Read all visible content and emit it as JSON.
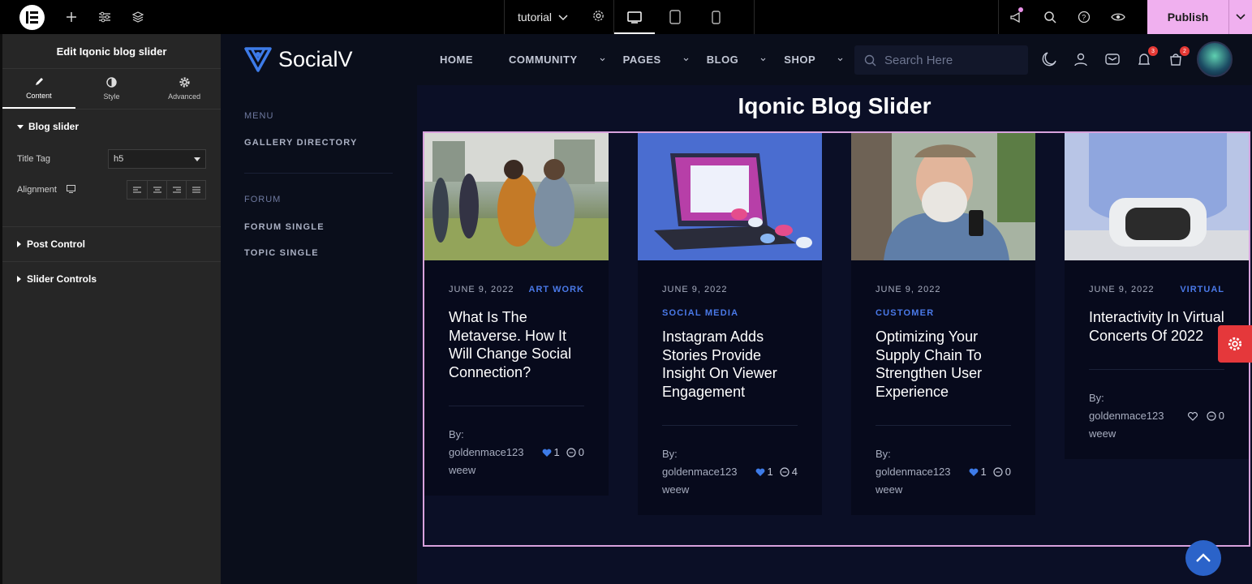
{
  "editor": {
    "doc_name": "tutorial",
    "publish_label": "Publish"
  },
  "panel": {
    "title": "Edit Iqonic blog slider",
    "tabs": [
      "Content",
      "Style",
      "Advanced"
    ],
    "section_blog": "Blog slider",
    "title_tag_label": "Title Tag",
    "title_tag_value": "h5",
    "alignment_label": "Alignment",
    "section_post": "Post Control",
    "section_slider": "Slider Controls"
  },
  "site": {
    "brand": "SocialV",
    "nav": [
      "HOME",
      "COMMUNITY",
      "PAGES",
      "BLOG",
      "SHOP"
    ],
    "search_placeholder": "Search Here",
    "notif_count": "3",
    "cart_count": "2",
    "side_menu": {
      "h1": "MENU",
      "i1": "GALLERY DIRECTORY",
      "h2": "FORUM",
      "i2": "FORUM SINGLE",
      "i3": "TOPIC SINGLE"
    },
    "heading": "Iqonic Blog Slider",
    "cards": [
      {
        "date": "JUNE 9, 2022",
        "category": "ART WORK",
        "title": "What Is The Metaverse. How It Will Change Social Connection?",
        "by": "By:",
        "author": "goldenmace123",
        "author2": "weew",
        "likes": "1",
        "comments": "0"
      },
      {
        "date": "JUNE 9, 2022",
        "category": "SOCIAL MEDIA",
        "title": "Instagram Adds Stories Provide Insight On Viewer Engagement",
        "by": "By:",
        "author": "goldenmace123",
        "author2": "weew",
        "likes": "1",
        "comments": "4"
      },
      {
        "date": "JUNE 9, 2022",
        "category": "CUSTOMER",
        "title": "Optimizing Your Supply Chain To Strengthen User Experience",
        "by": "By:",
        "author": "goldenmace123",
        "author2": "weew",
        "likes": "1",
        "comments": "0"
      },
      {
        "date": "JUNE 9, 2022",
        "category": "VIRTUAL",
        "title": "Interactivity In Virtual Concerts Of 2022",
        "by": "By:",
        "author": "goldenmace123",
        "author2": "weew",
        "likes": "",
        "comments": "0"
      }
    ]
  }
}
